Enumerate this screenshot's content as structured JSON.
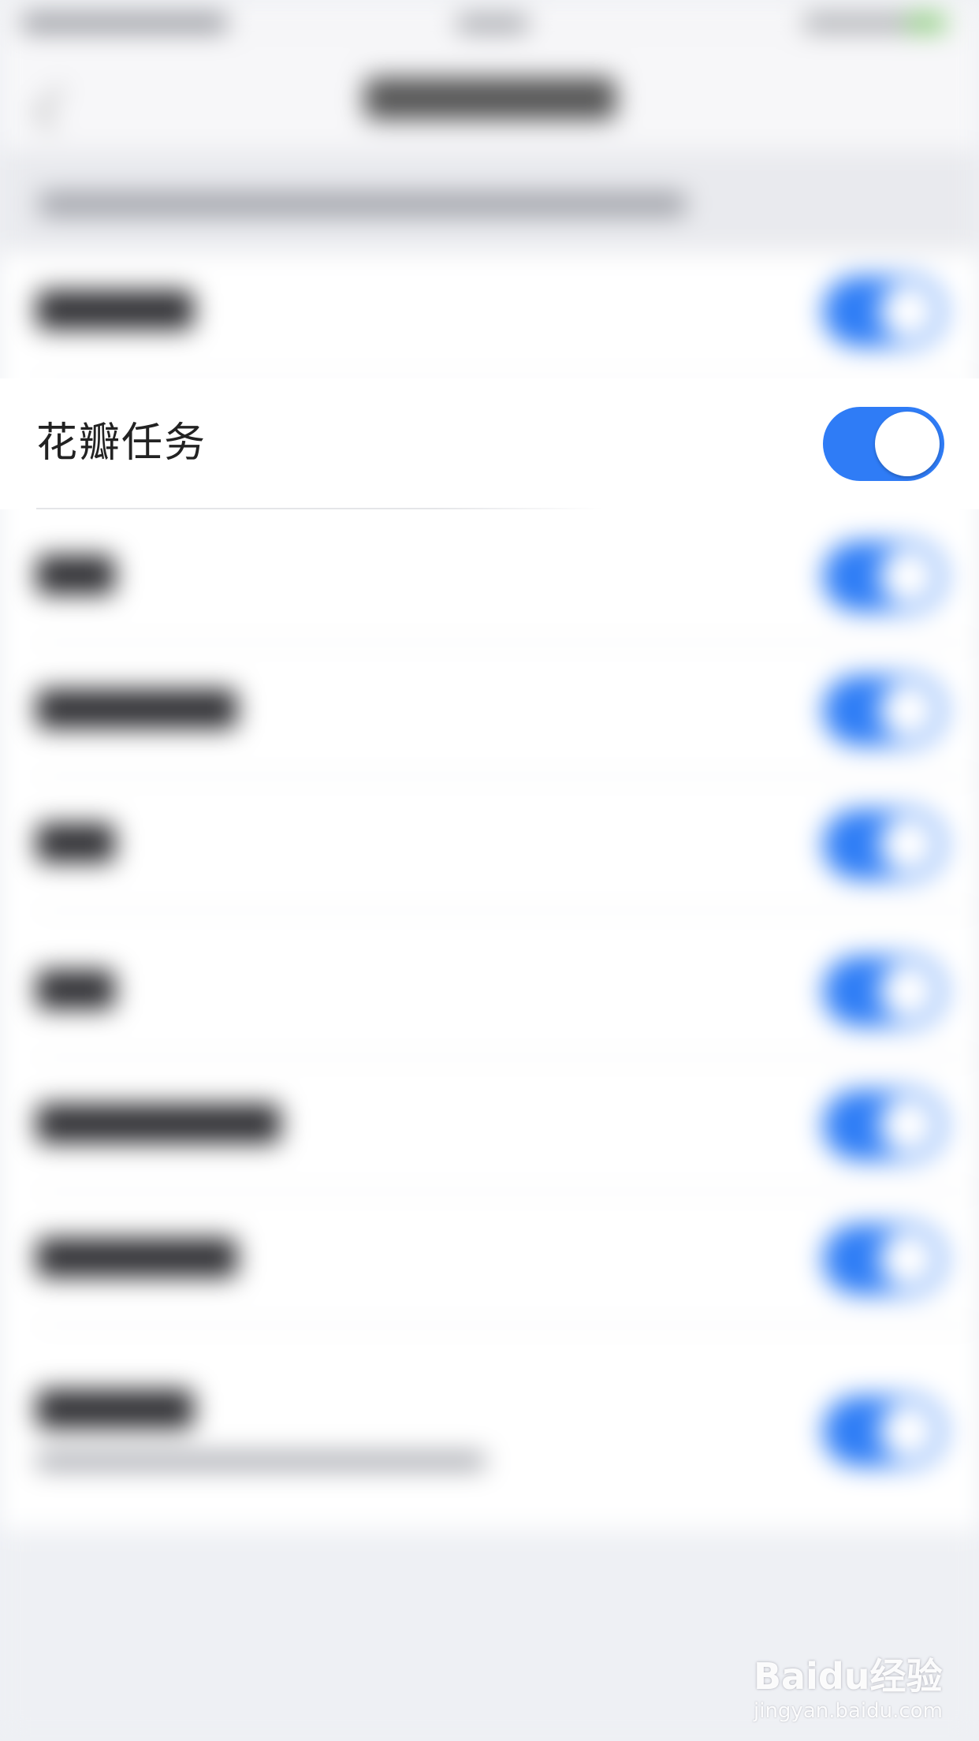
{
  "focused_row": {
    "label": "花瓣任务",
    "toggle_on": true
  },
  "colors": {
    "accent": "#2f7cf6",
    "background": "#eef0f4"
  },
  "watermark": {
    "brand": "Baidu经验",
    "url": "jingyan.baidu.com"
  }
}
